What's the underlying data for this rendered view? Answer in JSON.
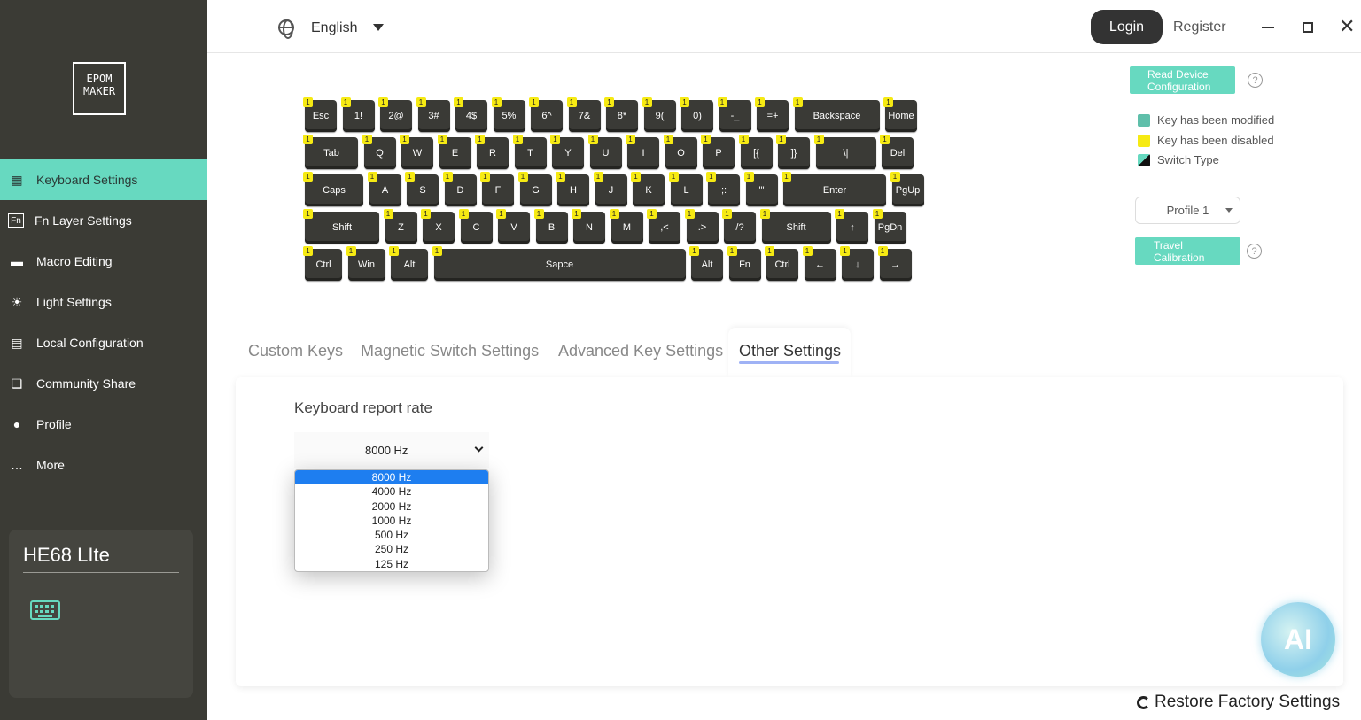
{
  "sidebar": {
    "logo_line1": "EPOM",
    "logo_line2": "MAKER",
    "items": [
      {
        "label": "Keyboard Settings",
        "icon": "keyboard-icon",
        "active": true
      },
      {
        "label": "Fn Layer Settings",
        "icon": "fn-icon",
        "active": false
      },
      {
        "label": "Macro Editing",
        "icon": "macro-icon",
        "active": false
      },
      {
        "label": "Light Settings",
        "icon": "light-icon",
        "active": false
      },
      {
        "label": "Local Configuration",
        "icon": "storage-icon",
        "active": false
      },
      {
        "label": "Community Share",
        "icon": "chat-icon",
        "active": false
      },
      {
        "label": "Profile",
        "icon": "user-icon",
        "active": false
      },
      {
        "label": "More",
        "icon": "more-icon",
        "active": false
      }
    ],
    "device": {
      "name": "HE68 LIte"
    }
  },
  "topbar": {
    "language": "English",
    "login": "Login",
    "register": "Register"
  },
  "keyboard": {
    "badge": "1",
    "rows": [
      [
        "Esc",
        "1!",
        "2@",
        "3#",
        "4$",
        "5%",
        "6^",
        "7&",
        "8*",
        "9(",
        "0)",
        "-_",
        "=+",
        "Backspace",
        "Home"
      ],
      [
        "Tab",
        "Q",
        "W",
        "E",
        "R",
        "T",
        "Y",
        "U",
        "I",
        "O",
        "P",
        "[{",
        "]}",
        "\\|",
        "Del"
      ],
      [
        "Caps",
        "A",
        "S",
        "D",
        "F",
        "G",
        "H",
        "J",
        "K",
        "L",
        ";:",
        "'\"",
        "Enter",
        "PgUp"
      ],
      [
        "Shift",
        "Z",
        "X",
        "C",
        "V",
        "B",
        "N",
        "M",
        ",<",
        ".>",
        "/?",
        "Shift",
        "↑",
        "PgDn"
      ],
      [
        "Ctrl",
        "Win",
        "Alt",
        "Sapce",
        "Alt",
        "Fn",
        "Ctrl",
        "←",
        "↓",
        "→"
      ]
    ]
  },
  "right_panel": {
    "read_config": "Read Device Configuration",
    "legend": [
      {
        "label": "Key has been modified",
        "color": "#5fbfaa"
      },
      {
        "label": "Key has been disabled",
        "color": "#f6ea13"
      },
      {
        "label": "Switch Type",
        "color": "#111111"
      }
    ],
    "profile": "Profile 1",
    "travel": "Travel Calibration"
  },
  "tabs": [
    {
      "label": "Custom Keys",
      "active": false
    },
    {
      "label": "Magnetic Switch Settings",
      "active": false
    },
    {
      "label": "Advanced Key Settings",
      "active": false
    },
    {
      "label": "Other Settings",
      "active": true
    }
  ],
  "report_rate": {
    "title": "Keyboard report rate",
    "selected": "8000 Hz",
    "options": [
      "8000 Hz",
      "4000 Hz",
      "2000 Hz",
      "1000 Hz",
      "500 Hz",
      "250 Hz",
      "125 Hz"
    ]
  },
  "ai": {
    "label": "AI"
  },
  "restore": {
    "label": "Restore Factory Settings"
  },
  "colors": {
    "accent": "#67d9c0",
    "sidebar": "#3b3b35",
    "key": "#3a3a36"
  }
}
